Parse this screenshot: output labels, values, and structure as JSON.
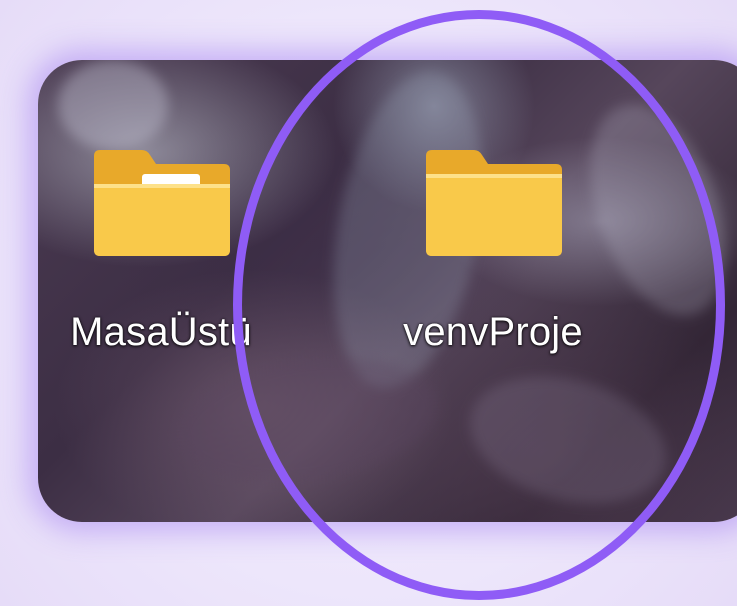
{
  "desktop": {
    "icons": [
      {
        "label": "MasaÜstü",
        "icon": "folder-with-document-icon"
      },
      {
        "label": "venvProje",
        "icon": "folder-icon"
      }
    ]
  },
  "annotation": {
    "shape": "ellipse",
    "color": "#8f5cf6",
    "target": "venvProje"
  },
  "colors": {
    "page_background": "#efe9fb",
    "glow": "#9a6ef0",
    "folder_front": "#f9c94a",
    "folder_back": "#e8a92a"
  }
}
